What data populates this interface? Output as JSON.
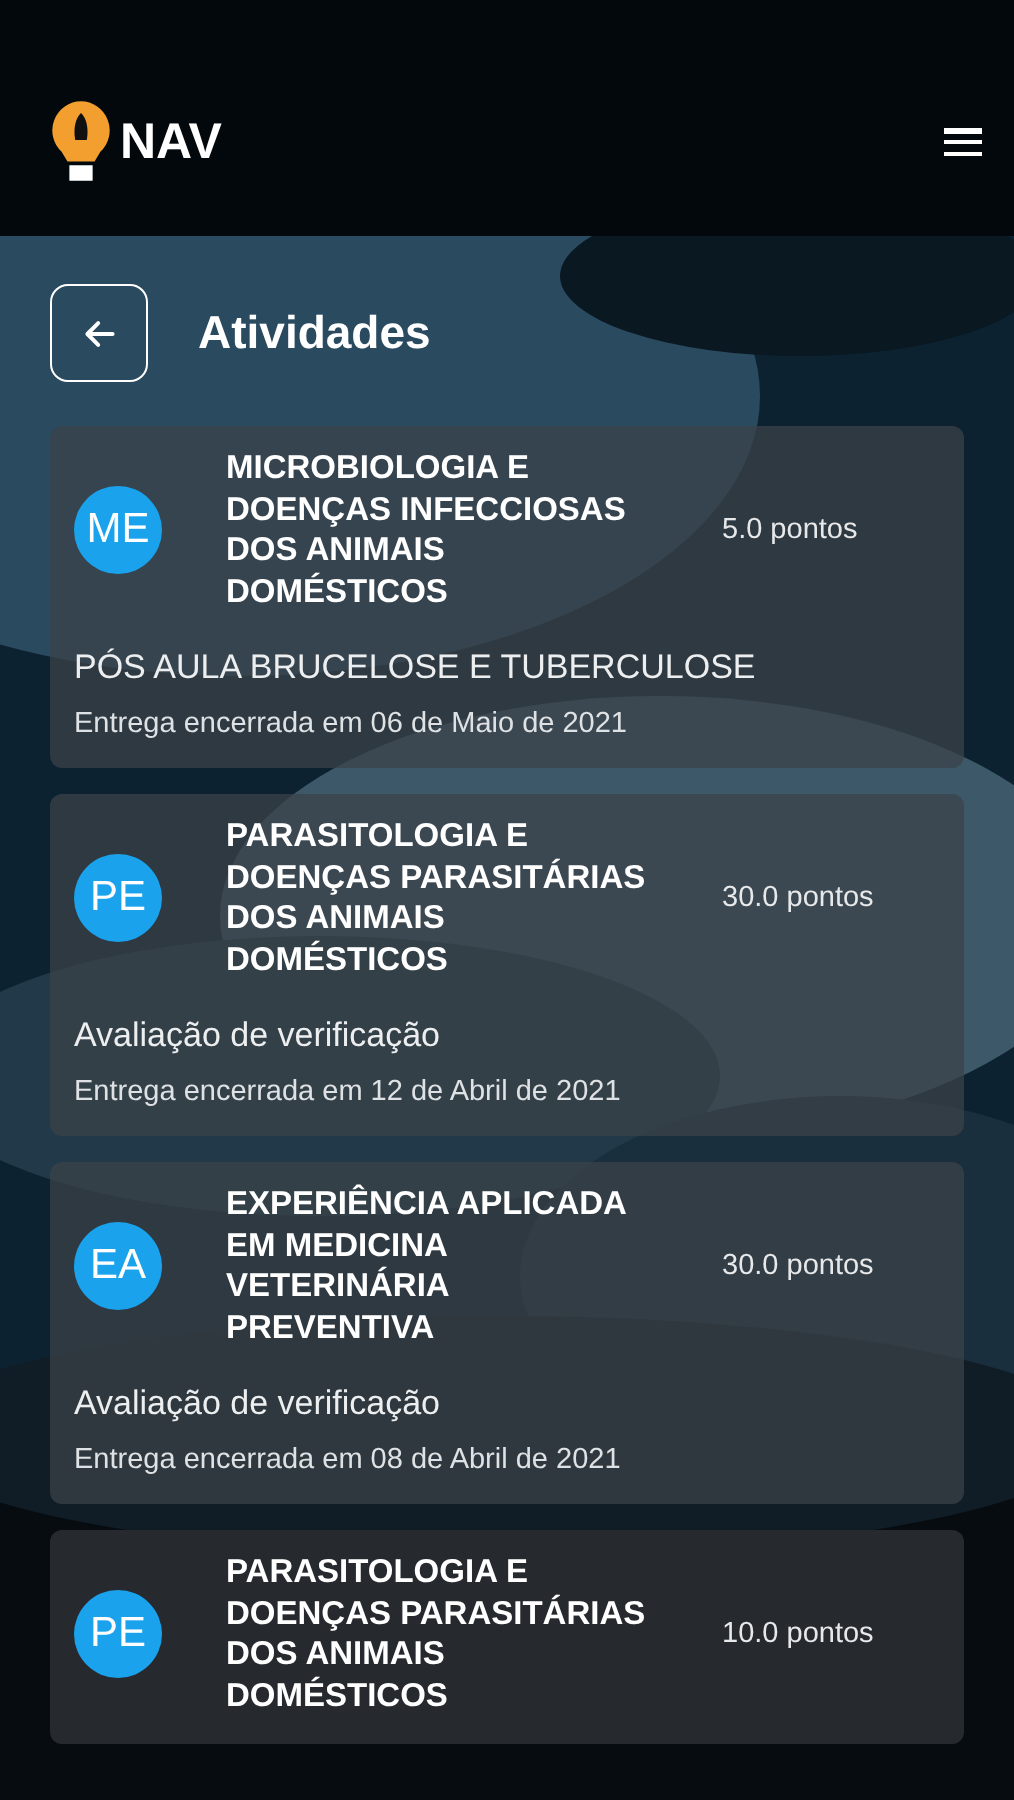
{
  "header": {
    "logo_text": "NAV"
  },
  "page": {
    "title": "Atividades"
  },
  "activities": [
    {
      "initials": "ME",
      "course": "MICROBIOLOGIA E DOENÇAS INFECCIOSAS DOS ANIMAIS DOMÉSTICOS",
      "points": "5.0 pontos",
      "description": "PÓS AULA BRUCELOSE E TUBERCULOSE",
      "deadline": "Entrega encerrada em 06 de Maio de 2021"
    },
    {
      "initials": "PE",
      "course": "PARASITOLOGIA E DOENÇAS PARASITÁRIAS DOS ANIMAIS DOMÉSTICOS",
      "points": "30.0 pontos",
      "description": "Avaliação de verificação",
      "deadline": "Entrega encerrada em 12 de Abril de 2021"
    },
    {
      "initials": "EA",
      "course": "EXPERIÊNCIA APLICADA EM MEDICINA VETERINÁRIA PREVENTIVA",
      "points": "30.0 pontos",
      "description": "Avaliação de verificação",
      "deadline": "Entrega encerrada em 08 de Abril de 2021"
    },
    {
      "initials": "PE",
      "course": "PARASITOLOGIA E DOENÇAS PARASITÁRIAS DOS ANIMAIS DOMÉSTICOS",
      "points": "10.0 pontos"
    }
  ]
}
